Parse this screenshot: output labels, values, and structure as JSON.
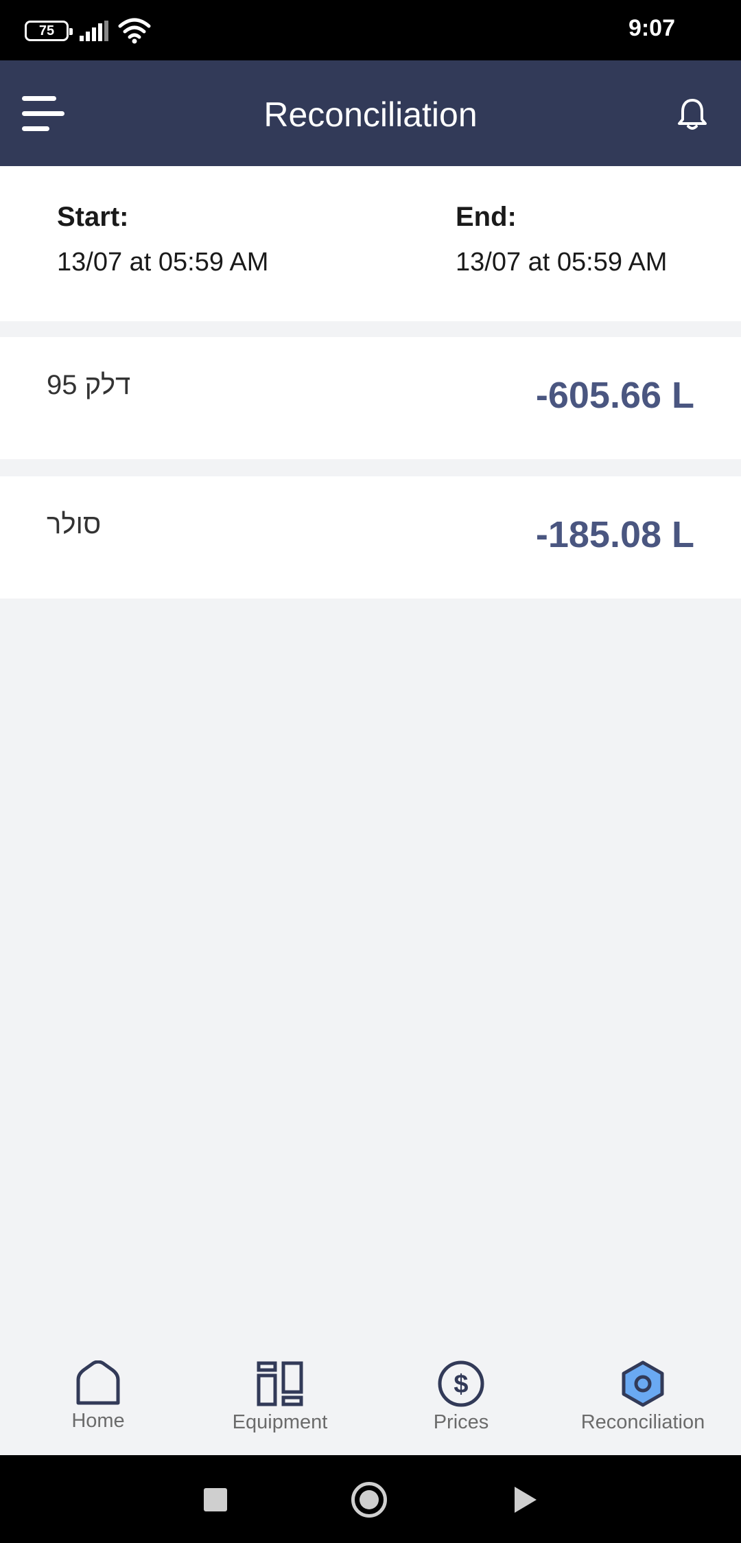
{
  "status_bar": {
    "battery": "75",
    "time": "9:07"
  },
  "header": {
    "title": "Reconciliation"
  },
  "period": {
    "start_label": "Start:",
    "start_value": "13/07 at 05:59 AM",
    "end_label": "End:",
    "end_value": "13/07 at 05:59 AM"
  },
  "fuels": [
    {
      "name": "דלק 95",
      "value": "-605.66 L"
    },
    {
      "name": "סולר",
      "value": "-185.08 L"
    }
  ],
  "bottom_nav": [
    {
      "label": "Home",
      "icon": "home-icon"
    },
    {
      "label": "Equipment",
      "icon": "equipment-icon"
    },
    {
      "label": "Prices",
      "icon": "dollar-icon"
    },
    {
      "label": "Reconciliation",
      "icon": "hexagon-icon",
      "active": true
    }
  ],
  "colors": {
    "header_bg": "#323a58",
    "value_text": "#4a5680",
    "active_icon": "#6aa9f2"
  }
}
